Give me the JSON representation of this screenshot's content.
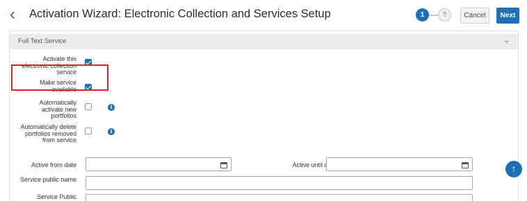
{
  "header": {
    "back_icon": "chevron-left-icon",
    "title": "Activation Wizard: Electronic Collection and Services Setup",
    "steps": [
      {
        "label": "1",
        "state": "active"
      },
      {
        "label": "?",
        "state": "inactive"
      }
    ],
    "cancel_label": "Cancel",
    "next_label": "Next",
    "accent_color": "#1f6fb5"
  },
  "section": {
    "title": "Full Text Service",
    "collapse_icon": "chevron-down-icon"
  },
  "fields": {
    "activate_service": {
      "label": "Activate this electronic collection service",
      "checked": true
    },
    "make_available": {
      "label": "Make service available",
      "checked": true
    },
    "auto_activate_portfolios": {
      "label": "Automatically activate new portfolios",
      "checked": false,
      "info_icon": "i"
    },
    "auto_delete_portfolios": {
      "label": "Automatically delete portfolios removed from service",
      "checked": false,
      "info_icon": "i"
    },
    "active_from": {
      "label": "Active from date",
      "value": ""
    },
    "active_until": {
      "label": "Active until date",
      "value": ""
    },
    "public_name": {
      "label": "Service public name",
      "value": ""
    },
    "public_note": {
      "label": "Service Public",
      "value": ""
    }
  },
  "scroll_top_icon": "arrow-up-icon"
}
